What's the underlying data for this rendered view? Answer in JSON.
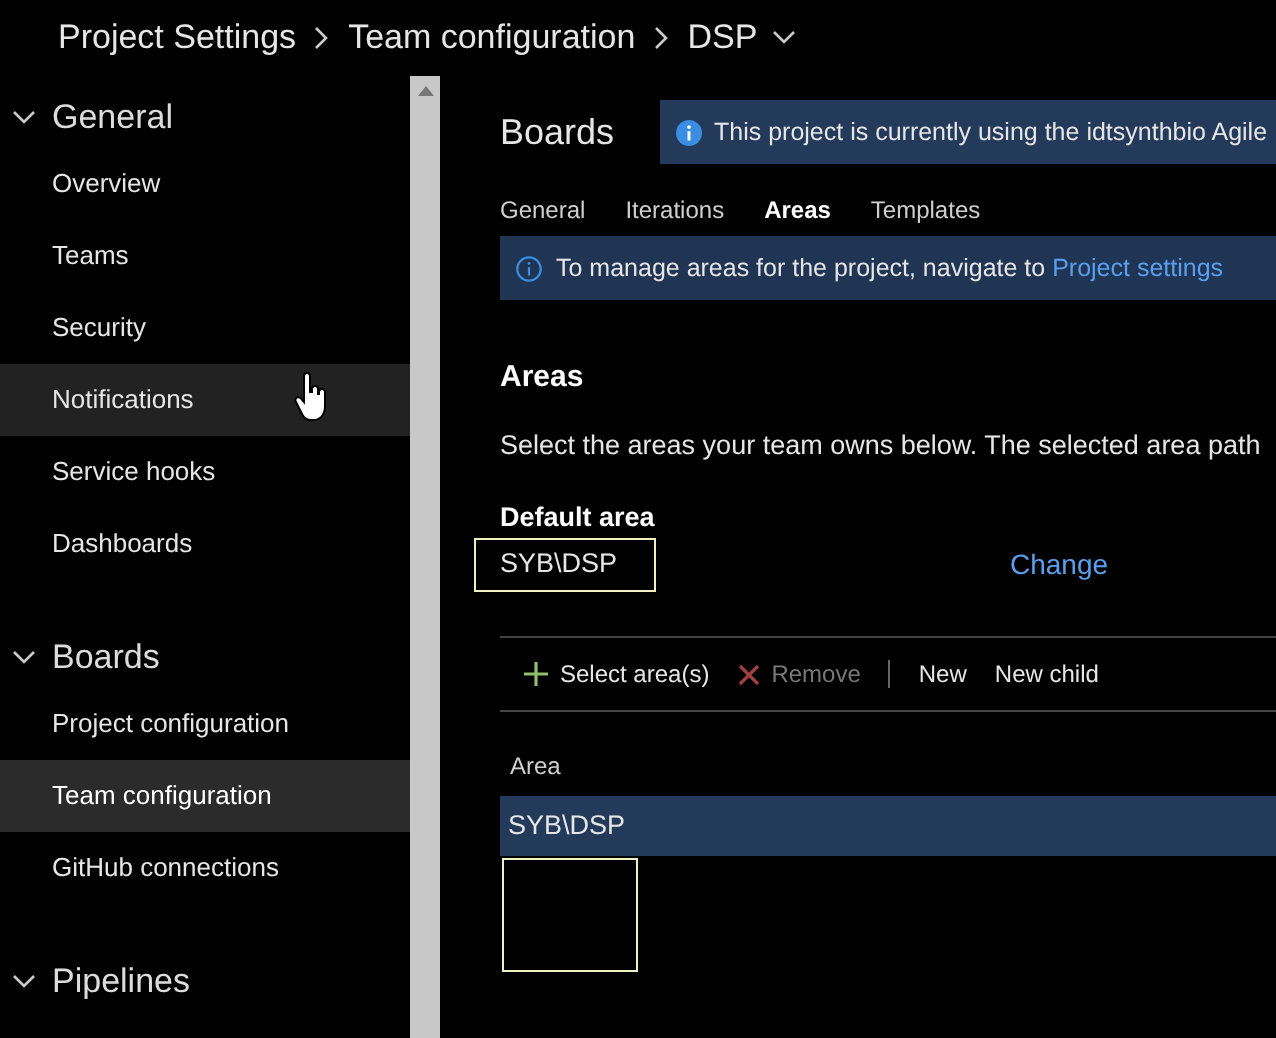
{
  "breadcrumb": [
    "Project Settings",
    "Team configuration",
    "DSP"
  ],
  "sidebar": {
    "groups": [
      {
        "title": "General",
        "expanded": true,
        "items": [
          {
            "label": "Overview",
            "selected": false,
            "hovered": false
          },
          {
            "label": "Teams",
            "selected": false,
            "hovered": false
          },
          {
            "label": "Security",
            "selected": false,
            "hovered": false
          },
          {
            "label": "Notifications",
            "selected": false,
            "hovered": true
          },
          {
            "label": "Service hooks",
            "selected": false,
            "hovered": false
          },
          {
            "label": "Dashboards",
            "selected": false,
            "hovered": false
          }
        ]
      },
      {
        "title": "Boards",
        "expanded": true,
        "items": [
          {
            "label": "Project configuration",
            "selected": false,
            "hovered": false
          },
          {
            "label": "Team configuration",
            "selected": true,
            "hovered": false
          },
          {
            "label": "GitHub connections",
            "selected": false,
            "hovered": false
          }
        ]
      },
      {
        "title": "Pipelines",
        "expanded": true
      }
    ]
  },
  "page": {
    "title": "Boards",
    "process_banner": "This project is currently using the idtsynthbio Agile",
    "tabs": [
      {
        "label": "General",
        "selected": false
      },
      {
        "label": "Iterations",
        "selected": false
      },
      {
        "label": "Areas",
        "selected": true
      },
      {
        "label": "Templates",
        "selected": false
      }
    ],
    "info_banner": {
      "text": "To manage areas for the project, navigate to ",
      "link": "Project settings"
    },
    "section_title": "Areas",
    "description": "Select the areas your team owns below. The selected area path",
    "default_area": {
      "label": "Default area",
      "value": "SYB\\DSP",
      "action": "Change"
    },
    "toolbar": [
      {
        "label": "Select area(s)",
        "kind": "add",
        "disabled": false
      },
      {
        "label": "Remove",
        "kind": "remove",
        "disabled": true
      },
      {
        "kind": "separator"
      },
      {
        "label": "New",
        "kind": "plain",
        "disabled": false
      },
      {
        "label": "New child",
        "kind": "plain",
        "disabled": false
      }
    ],
    "table": {
      "columns": [
        "Area"
      ],
      "rows": [
        {
          "area": "SYB\\DSP",
          "selected": true
        }
      ]
    }
  }
}
